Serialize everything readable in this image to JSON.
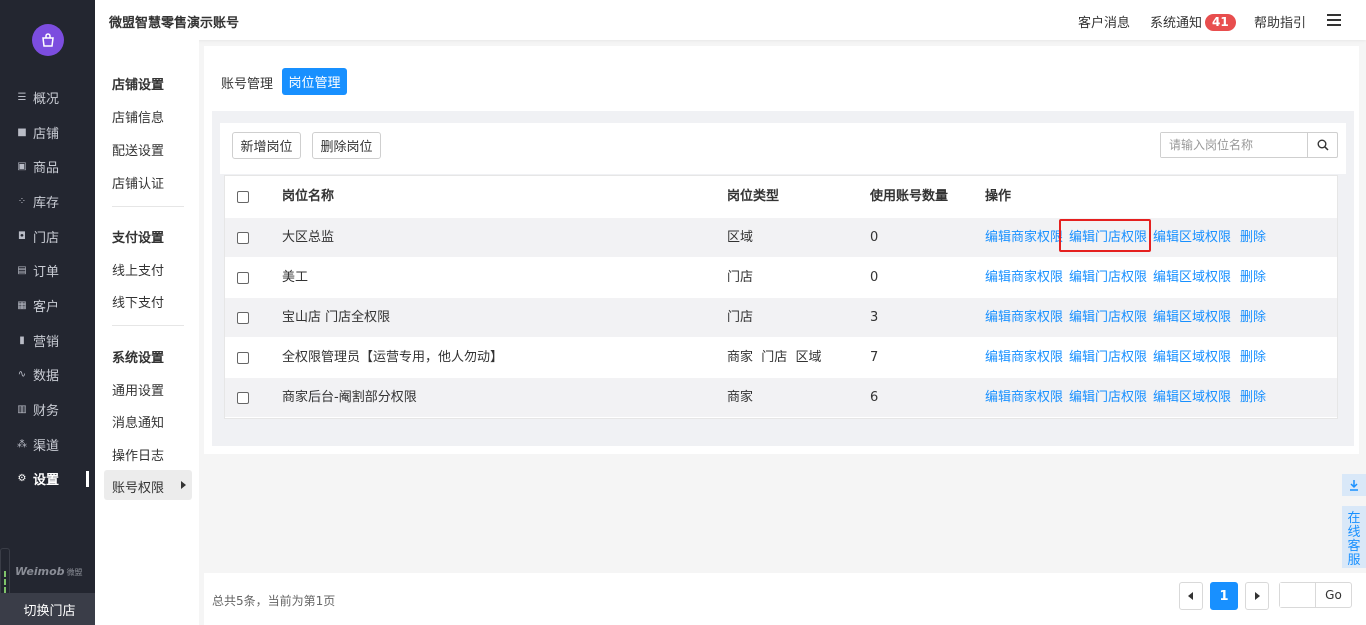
{
  "header": {
    "account_title": "微盟智慧零售演示账号",
    "customer_msg": "客户消息",
    "sys_notice": "系统通知",
    "sys_notice_count": "41",
    "help": "帮助指引"
  },
  "leftnav": {
    "items": [
      {
        "label": "概况",
        "icon": "overview-icon"
      },
      {
        "label": "店铺",
        "icon": "shop-icon"
      },
      {
        "label": "商品",
        "icon": "goods-icon"
      },
      {
        "label": "库存",
        "icon": "inventory-icon"
      },
      {
        "label": "门店",
        "icon": "store-icon"
      },
      {
        "label": "订单",
        "icon": "order-icon"
      },
      {
        "label": "客户",
        "icon": "customer-icon"
      },
      {
        "label": "营销",
        "icon": "marketing-icon"
      },
      {
        "label": "数据",
        "icon": "data-icon"
      },
      {
        "label": "财务",
        "icon": "finance-icon"
      },
      {
        "label": "渠道",
        "icon": "channel-icon"
      },
      {
        "label": "设置",
        "icon": "settings-icon"
      }
    ],
    "active_index": 11,
    "brand": "Weimob",
    "brand_cn": "微盟",
    "switch_store": "切换门店"
  },
  "subnav": {
    "groups": [
      {
        "title": "店铺设置",
        "items": [
          "店铺信息",
          "配送设置",
          "店铺认证"
        ]
      },
      {
        "title": "支付设置",
        "items": [
          "线上支付",
          "线下支付"
        ]
      },
      {
        "title": "系统设置",
        "items": [
          "通用设置",
          "消息通知",
          "操作日志",
          "账号权限"
        ]
      }
    ],
    "active_item": "账号权限"
  },
  "tabs": {
    "account_mgmt": "账号管理",
    "position_mgmt": "岗位管理"
  },
  "toolbar": {
    "add_label": "新增岗位",
    "delete_label": "删除岗位",
    "search_placeholder": "请输入岗位名称"
  },
  "table": {
    "columns": [
      "岗位名称",
      "岗位类型",
      "使用账号数量",
      "操作"
    ],
    "rows": [
      {
        "name": "大区总监",
        "type": "区域",
        "count": "0"
      },
      {
        "name": "美工",
        "type": "门店",
        "count": "0"
      },
      {
        "name": "宝山店 门店全权限",
        "type": "门店",
        "count": "3"
      },
      {
        "name": "全权限管理员【运营专用，他人勿动】",
        "type": "商家  门店  区域",
        "count": "7"
      },
      {
        "name": "商家后台-阉割部分权限",
        "type": "商家",
        "count": "6"
      }
    ],
    "ops": {
      "edit_merchant": "编辑商家权限",
      "edit_store": "编辑门店权限",
      "edit_region": "编辑区域权限",
      "delete": "删除"
    }
  },
  "floating": {
    "online_service": "在线客服"
  },
  "footer": {
    "summary": "总共5条，当前为第1页",
    "current_page": "1",
    "go": "Go"
  },
  "colors": {
    "accent": "#1890ff",
    "nav_bg": "#232630",
    "badge": "#e84e4e",
    "highlight_border": "#e5201f"
  }
}
